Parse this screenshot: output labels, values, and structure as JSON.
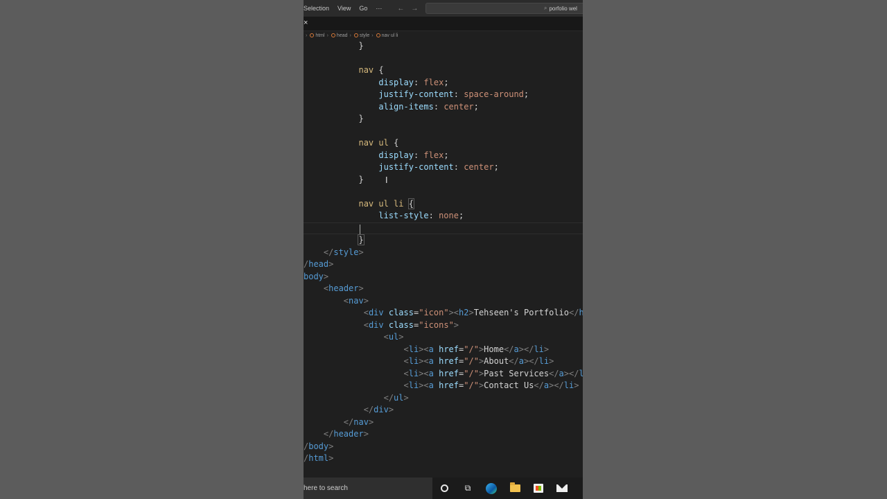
{
  "titlebar": {
    "menu": [
      "Selection",
      "View",
      "Go",
      "···"
    ],
    "back_arrow": "←",
    "forward_arrow": "→",
    "search_text": "porfolio wel"
  },
  "tab": {
    "close_glyph": "×"
  },
  "breadcrumb": [
    "html",
    "head",
    "style",
    "nav ul li"
  ],
  "cursor_glyph": "I",
  "taskbar": {
    "search_placeholder": "here to search"
  },
  "colors": {
    "background": "#1f1f1f",
    "tag": "#569cd6",
    "property": "#9cdcfe",
    "value": "#ce9178",
    "selector": "#d7ba7d",
    "brace": "#ffd700"
  }
}
